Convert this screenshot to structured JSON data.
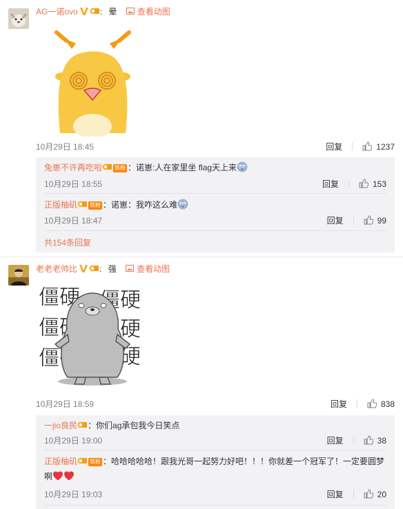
{
  "comments": [
    {
      "username": "AG一诺ovo",
      "text": "晕",
      "view_link": "查看动图",
      "timestamp": "10月29日 18:45",
      "reply_label": "回复",
      "likes": "1237",
      "replies": [
        {
          "username": "兔崽不许再吃啦",
          "fan_badge": "铁粉",
          "text": "诺崽:人在家里坐 flag天上来",
          "timestamp": "10月29日 18:55",
          "reply_label": "回复",
          "likes": "153"
        },
        {
          "username": "正版柚矶",
          "fan_badge": "铁粉",
          "text": "诺崽：我咋这么难",
          "timestamp": "10月29日 18:47",
          "reply_label": "回复",
          "likes": "99"
        }
      ],
      "more_replies": "共154条回复"
    },
    {
      "username": "老老老帅比",
      "text": "强",
      "view_link": "查看动图",
      "timestamp": "10月29日 18:59",
      "reply_label": "回复",
      "likes": "838",
      "sticker_text": "僵硬",
      "replies": [
        {
          "username": "一jio良民",
          "text": "你们ag承包我今日笑点",
          "timestamp": "10月29日 19:00",
          "reply_label": "回复",
          "likes": "38"
        },
        {
          "username": "正版柚矶",
          "fan_badge": "铁粉",
          "text": "哈哈哈哈哈！跟我光哥一起努力好吧！！！你就差一个冠军了！一定要圆梦",
          "text_cont": "啊",
          "timestamp": "10月29日 19:03",
          "reply_label": "回复",
          "likes": "20"
        }
      ]
    }
  ],
  "colors": {
    "username": "#eb7350",
    "meta": "#808080",
    "reply_bg": "#f2f2f5",
    "badge": "#ff8200",
    "verified": "#f5a623"
  }
}
